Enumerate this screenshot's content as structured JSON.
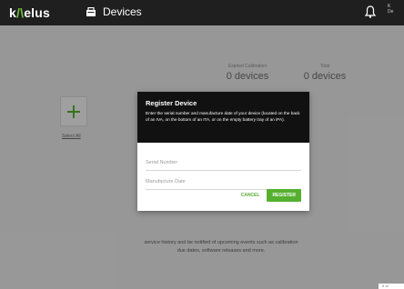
{
  "app": {
    "logo_prefix": "k",
    "logo_accent": "/\\",
    "logo_suffix": "elus",
    "nav_label": "Devices",
    "user_initial": "K",
    "user_name": "De"
  },
  "stats": [
    {
      "label": "Expired Calibration",
      "value": "0 devices"
    },
    {
      "label": "Total",
      "value": "0 devices"
    }
  ],
  "main": {
    "select_all": "Select All",
    "info_line1": "service history and be notified of upcoming events such as calibration",
    "info_line2": "due dates, software releases and more."
  },
  "modal": {
    "title": "Register Device",
    "description": "Enter the serial number and manufacture date of your device (located on the back of an IVA, on the bottom of an ITA, or on the empty battery tray of an iPA).",
    "serial_placeholder": "Serial Number",
    "date_placeholder": "Manufacture Date",
    "cancel_label": "CANCEL",
    "register_label": "REGISTER"
  },
  "corner": {
    "label": "5 of"
  },
  "colors": {
    "accent": "#56b02f",
    "topbar": "#1f1f1f",
    "modal_header": "#111111"
  },
  "icons": {
    "nav": "devices-icon",
    "bell": "bell-icon",
    "add": "plus-icon"
  }
}
